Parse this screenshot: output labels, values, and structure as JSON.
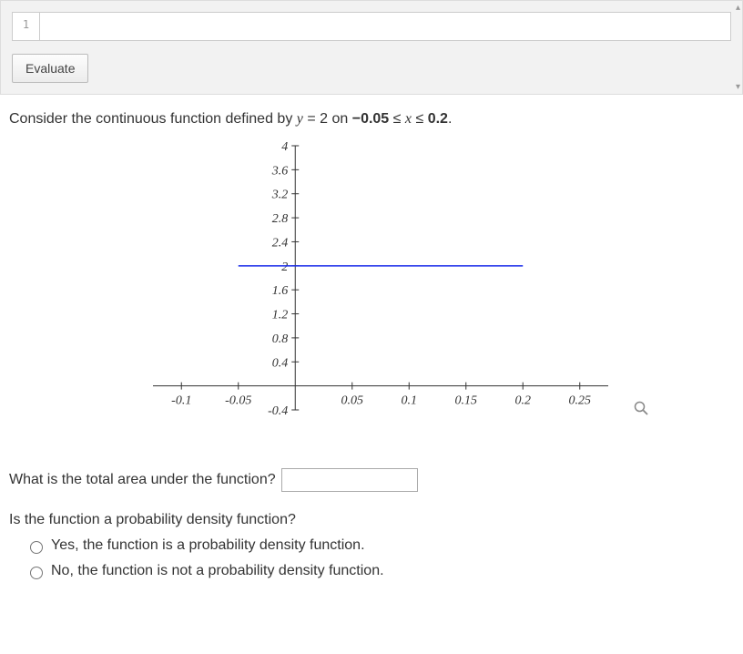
{
  "panel": {
    "line_number": "1",
    "evaluate_label": "Evaluate",
    "code_value": ""
  },
  "prompt": {
    "prefix": "Consider the continuous function defined by ",
    "eq_lhs": "y",
    "eq_mid": " = 2",
    "on_text": " on ",
    "domain_lo": "−0.05",
    "leq1": " ≤ ",
    "x_var": "x",
    "leq2": " ≤ ",
    "domain_hi": "0.2",
    "period": "."
  },
  "chart_data": {
    "type": "line",
    "x": [
      -0.05,
      0.2
    ],
    "y": [
      2,
      2
    ],
    "xlim": [
      -0.125,
      0.275
    ],
    "ylim": [
      -0.4,
      4
    ],
    "x_ticks": [
      -0.1,
      -0.05,
      0.05,
      0.1,
      0.15,
      0.2,
      0.25
    ],
    "y_ticks": [
      -0.4,
      0.4,
      0.8,
      1.2,
      1.6,
      2,
      2.4,
      2.8,
      3.2,
      3.6,
      4
    ],
    "line_color": "#1b2ee9"
  },
  "area_question": {
    "text": "What is the total area under the function?",
    "value": ""
  },
  "pdf_question": {
    "text": "Is the function a probability density function?",
    "option_yes": "Yes, the function is a probability density function.",
    "option_no": "No, the function is not a probability density function."
  }
}
